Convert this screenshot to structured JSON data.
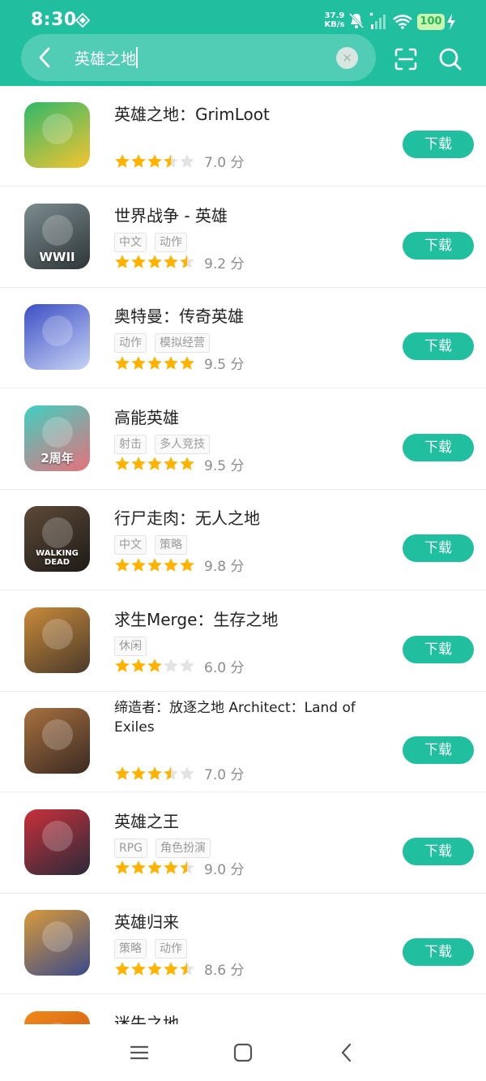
{
  "status_bar": {
    "time": "8:30",
    "net_speed_value": "37.9",
    "net_speed_unit": "KB/s",
    "battery": "100"
  },
  "search": {
    "query": "英雄之地",
    "clear_label": "×"
  },
  "colors": {
    "accent": "#1fbf9f",
    "star_on": "#ffb300",
    "star_off": "#e3e3e3"
  },
  "download_label": "下载",
  "apps": [
    {
      "title": "英雄之地：GrimLoot",
      "tags": [],
      "stars": 3.5,
      "score": "7.0 分",
      "icon_text": "",
      "icon_bg": [
        "#2fb86a",
        "#f5c430"
      ]
    },
    {
      "title": "世界战争 - 英雄",
      "tags": [
        "中文",
        "动作"
      ],
      "stars": 4.5,
      "score": "9.2 分",
      "icon_text": "WWII",
      "icon_bg": [
        "#7b8c8f",
        "#2e3538"
      ]
    },
    {
      "title": "奥特曼：传奇英雄",
      "tags": [
        "动作",
        "模拟经营"
      ],
      "stars": 5,
      "score": "9.5 分",
      "icon_text": "",
      "icon_bg": [
        "#3c4fc4",
        "#c7d4f5"
      ]
    },
    {
      "title": "高能英雄",
      "tags": [
        "射击",
        "多人竞技"
      ],
      "stars": 5,
      "score": "9.5 分",
      "icon_text": "2周年",
      "icon_bg": [
        "#3fd0c2",
        "#e8707a"
      ]
    },
    {
      "title": "行尸走肉：无人之地",
      "tags": [
        "中文",
        "策略"
      ],
      "stars": 5,
      "score": "9.8 分",
      "icon_text": "WALKING DEAD",
      "icon_bg": [
        "#5d4a38",
        "#1e1a17"
      ]
    },
    {
      "title": "求生Merge：生存之地",
      "tags": [
        "休闲"
      ],
      "stars": 3,
      "score": "6.0 分",
      "icon_text": "",
      "icon_bg": [
        "#c98a3a",
        "#4a3a2a"
      ]
    },
    {
      "title": "缔造者：放逐之地 Architect：Land of Exiles",
      "tags": [],
      "stars": 3.5,
      "score": "7.0 分",
      "icon_text": "",
      "icon_bg": [
        "#a8713f",
        "#3a2a22"
      ]
    },
    {
      "title": "英雄之王",
      "tags": [
        "RPG",
        "角色扮演"
      ],
      "stars": 4.5,
      "score": "9.0 分",
      "icon_text": "",
      "icon_bg": [
        "#c9303a",
        "#2a2a3a"
      ]
    },
    {
      "title": "英雄归来",
      "tags": [
        "策略",
        "动作"
      ],
      "stars": 4.5,
      "score": "8.6 分",
      "icon_text": "",
      "icon_bg": [
        "#d99a3a",
        "#3a4a8a"
      ]
    },
    {
      "title": "迷失之地",
      "tags": [],
      "stars": 0,
      "score": "",
      "icon_text": "",
      "icon_bg": [
        "#f08a1a",
        "#c24a10"
      ]
    }
  ]
}
